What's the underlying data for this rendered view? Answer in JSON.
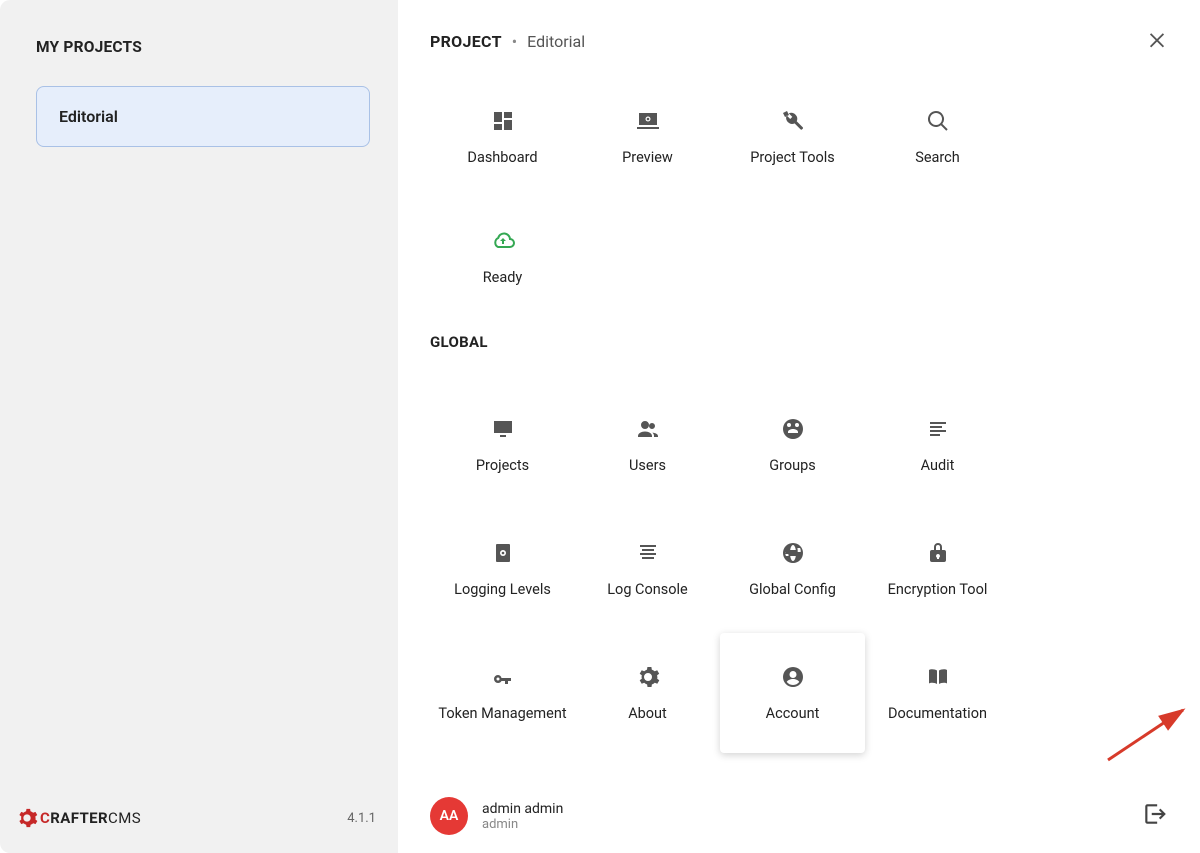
{
  "sidebar": {
    "title": "MY PROJECTS",
    "project": "Editorial",
    "version": "4.1.1",
    "logo_brand": "RAFTER",
    "logo_suffix": "CMS"
  },
  "header": {
    "label": "PROJECT",
    "current": "Editorial"
  },
  "project_tiles": {
    "dashboard": "Dashboard",
    "preview": "Preview",
    "tools": "Project Tools",
    "search": "Search",
    "ready": "Ready"
  },
  "global": {
    "label": "GLOBAL",
    "tiles": {
      "projects": "Projects",
      "users": "Users",
      "groups": "Groups",
      "audit": "Audit",
      "logging": "Logging Levels",
      "logconsole": "Log Console",
      "globalconfig": "Global Config",
      "encryption": "Encryption Tool",
      "token": "Token Management",
      "about": "About",
      "account": "Account",
      "docs": "Documentation"
    }
  },
  "user": {
    "initials": "AA",
    "display": "admin admin",
    "username": "admin"
  }
}
